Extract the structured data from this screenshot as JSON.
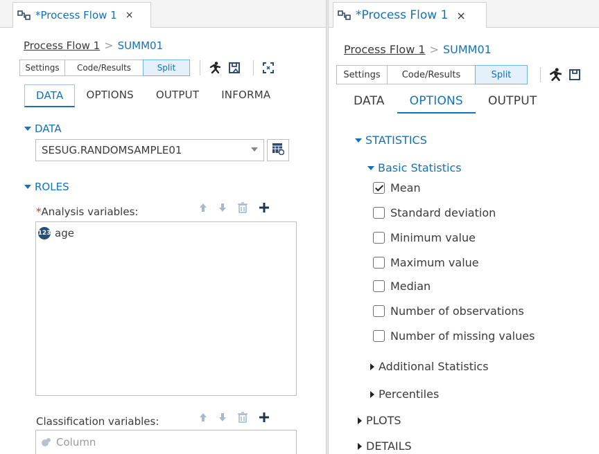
{
  "left": {
    "tab": {
      "title": "*Process Flow 1",
      "close": "×"
    },
    "breadcrumb": {
      "parent": "Process Flow 1",
      "separator": ">",
      "current": "SUMM01"
    },
    "view_buttons": [
      "Settings",
      "Code/Results",
      "Split"
    ],
    "subtabs": [
      "DATA",
      "OPTIONS",
      "OUTPUT",
      "INFORMA"
    ],
    "data_section": {
      "header": "DATA",
      "dataset": "SESUG.RANDOMSAMPLE01"
    },
    "roles_section": {
      "header": "ROLES",
      "required_mark": "*",
      "analysis_label": "Analysis variables:",
      "analysis_items": [
        {
          "badge": "123",
          "name": "age"
        }
      ],
      "classification_label": "Classification variables:",
      "classification_placeholder": "Column"
    }
  },
  "right": {
    "tab": {
      "title": "*Process Flow 1",
      "close": "×"
    },
    "breadcrumb": {
      "parent": "Process Flow 1",
      "separator": ">",
      "current": "SUMM01"
    },
    "view_buttons": [
      "Settings",
      "Code/Results",
      "Split"
    ],
    "subtabs": [
      "DATA",
      "OPTIONS",
      "OUTPUT"
    ],
    "statistics": {
      "header": "STATISTICS",
      "basic_header": "Basic Statistics",
      "basic_items": [
        {
          "label": "Mean",
          "checked": true
        },
        {
          "label": "Standard deviation",
          "checked": false
        },
        {
          "label": "Minimum value",
          "checked": false
        },
        {
          "label": "Maximum value",
          "checked": false
        },
        {
          "label": "Median",
          "checked": false
        },
        {
          "label": "Number of observations",
          "checked": false
        },
        {
          "label": "Number of missing values",
          "checked": false
        }
      ],
      "additional": "Additional Statistics",
      "percentiles": "Percentiles"
    },
    "plots": "PLOTS",
    "details": "DETAILS"
  },
  "colors": {
    "accent": "#1670b8",
    "required": "#c0392b",
    "badge": "#274f78"
  }
}
